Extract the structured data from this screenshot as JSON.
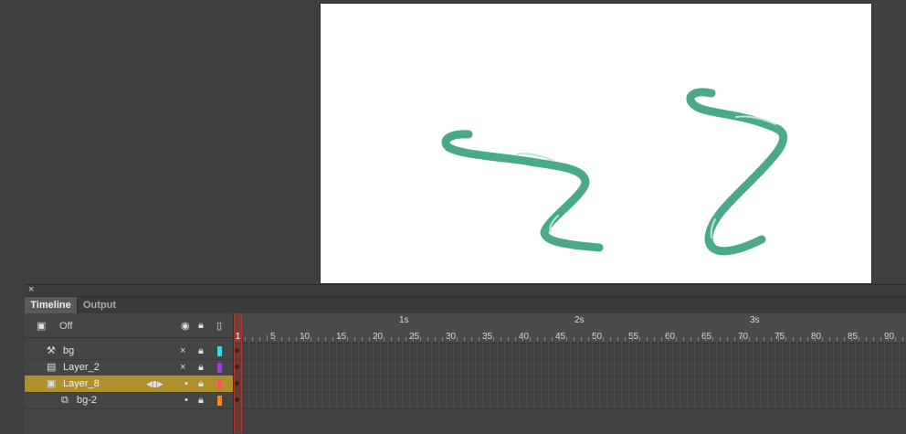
{
  "panel": {
    "close": "×",
    "tabs": [
      {
        "label": "Timeline",
        "active": true
      },
      {
        "label": "Output",
        "active": false
      }
    ]
  },
  "header_row": {
    "label": "Off",
    "icons": [
      "camera-icon",
      "eye-icon",
      "lock-icon",
      "outline-icon"
    ]
  },
  "layers": [
    {
      "name": "bg",
      "type": "guide",
      "visibility": "×",
      "color": "#35d9e8"
    },
    {
      "name": "Layer_2",
      "type": "normal",
      "visibility": "×",
      "color": "#9b3fd1"
    },
    {
      "name": "Layer_8",
      "type": "normal",
      "visibility": "•",
      "color": "#ef5a5a",
      "selected": true
    },
    {
      "name": "bg-2",
      "type": "masked",
      "visibility": "•",
      "color": "#f08a2a"
    }
  ],
  "ruler": {
    "seconds": [
      "1s",
      "2s",
      "3s"
    ],
    "ticks": [
      "5",
      "10",
      "15",
      "20",
      "25",
      "30",
      "35",
      "40",
      "45",
      "50",
      "55",
      "60",
      "65",
      "70",
      "75",
      "80",
      "85",
      "90"
    ],
    "current_frame": "1"
  },
  "colors": {
    "stroke": "#4aa98a",
    "selection": "#b0902c",
    "playhead": "#a8352a"
  }
}
